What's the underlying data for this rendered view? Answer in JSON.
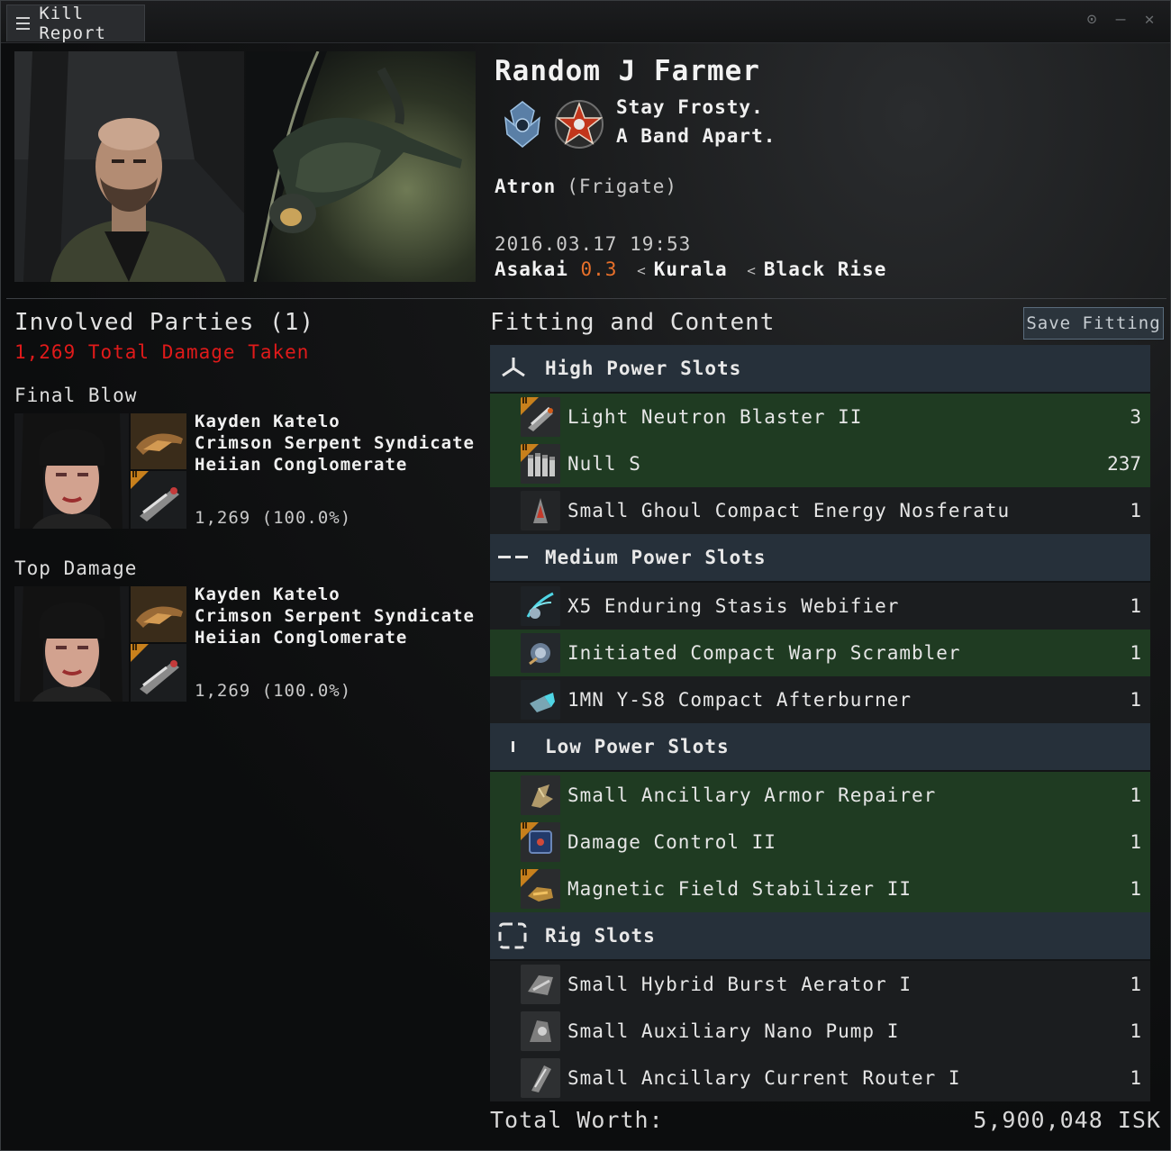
{
  "window": {
    "title": "Kill Report"
  },
  "victim": {
    "name": "Random J Farmer",
    "corporation": "Stay Frosty.",
    "alliance": "A Band Apart.",
    "ship": "Atron",
    "ship_class": "(Frigate)",
    "datetime": "2016.03.17  19:53",
    "location": {
      "system": "Asakai",
      "security": "0.3",
      "constellation": "Kurala",
      "region": "Black Rise",
      "separator": "<"
    }
  },
  "involved": {
    "title": "Involved Parties  (1)",
    "damage_taken": "1,269 Total Damage Taken",
    "final_blow": {
      "label": "Final Blow",
      "name": "Kayden Katelo",
      "corporation": "Crimson Serpent Syndicate",
      "alliance": "Heiian Conglomerate",
      "damage": "1,269 (100.0%)"
    },
    "top_damage": {
      "label": "Top Damage",
      "name": "Kayden Katelo",
      "corporation": "Crimson Serpent Syndicate",
      "alliance": "Heiian Conglomerate",
      "damage": "1,269 (100.0%)"
    }
  },
  "fitting": {
    "title": "Fitting and Content",
    "save_button": "Save Fitting",
    "slots": [
      {
        "label": "High Power Slots",
        "icon": "high-slot-icon",
        "items": [
          {
            "name": "Light Neutron Blaster II",
            "qty": "3",
            "status": "dropped",
            "tech2": true,
            "icon": "blaster-icon"
          },
          {
            "name": "Null S",
            "qty": "237",
            "status": "dropped",
            "tech2": true,
            "icon": "ammo-icon"
          },
          {
            "name": "Small Ghoul Compact Energy Nosferatu",
            "qty": "1",
            "status": "destroyed",
            "tech2": false,
            "icon": "nosferatu-icon"
          }
        ]
      },
      {
        "label": "Medium Power Slots",
        "icon": "mid-slot-icon",
        "items": [
          {
            "name": "X5 Enduring Stasis Webifier",
            "qty": "1",
            "status": "destroyed",
            "tech2": false,
            "icon": "webifier-icon"
          },
          {
            "name": "Initiated Compact Warp Scrambler",
            "qty": "1",
            "status": "dropped",
            "tech2": false,
            "icon": "scrambler-icon"
          },
          {
            "name": "1MN Y-S8 Compact Afterburner",
            "qty": "1",
            "status": "destroyed",
            "tech2": false,
            "icon": "afterburner-icon"
          }
        ]
      },
      {
        "label": "Low Power Slots",
        "icon": "low-slot-icon",
        "items": [
          {
            "name": "Small Ancillary Armor Repairer",
            "qty": "1",
            "status": "dropped",
            "tech2": false,
            "icon": "armor-repairer-icon"
          },
          {
            "name": "Damage Control II",
            "qty": "1",
            "status": "dropped",
            "tech2": true,
            "icon": "damage-control-icon"
          },
          {
            "name": "Magnetic Field Stabilizer II",
            "qty": "1",
            "status": "dropped",
            "tech2": true,
            "icon": "mag-stab-icon"
          }
        ]
      },
      {
        "label": "Rig Slots",
        "icon": "rig-slot-icon",
        "items": [
          {
            "name": "Small Hybrid Burst Aerator I",
            "qty": "1",
            "status": "destroyed",
            "tech2": false,
            "icon": "rig-icon"
          },
          {
            "name": "Small Auxiliary Nano Pump I",
            "qty": "1",
            "status": "destroyed",
            "tech2": false,
            "icon": "rig-icon"
          },
          {
            "name": "Small Ancillary Current Router I",
            "qty": "1",
            "status": "destroyed",
            "tech2": false,
            "icon": "rig-icon"
          }
        ]
      }
    ]
  },
  "total": {
    "label": "Total Worth:",
    "value": "5,900,048 ISK"
  },
  "colors": {
    "dropped": "#1f3b22",
    "destroyed": "#1b1d1f",
    "security": "#e8702a",
    "damage": "#e01a1a",
    "slot_header": "#26303a"
  }
}
